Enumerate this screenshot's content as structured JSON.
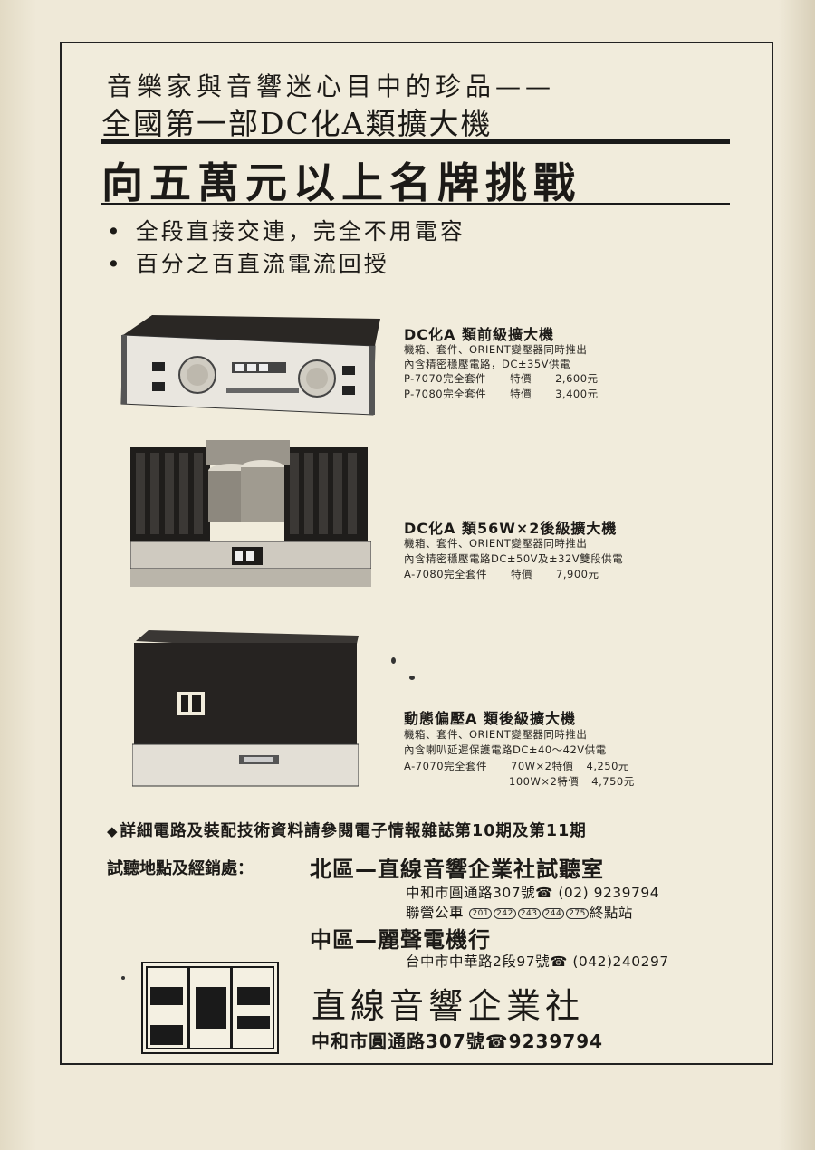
{
  "header": {
    "tagline": "音樂家與音響迷心目中的珍品——",
    "subtitle": "全國第一部DC化A類擴大機",
    "headline": "向五萬元以上名牌挑戰",
    "features": [
      "全段直接交連，完全不用電容",
      "百分之百直流電流回授"
    ],
    "bullet": "•"
  },
  "products": [
    {
      "title": "DC化A 類前級擴大機",
      "lines": [
        "機箱、套件、ORIENT變壓器同時推出",
        "內含精密穩壓電路，DC±35V供電"
      ],
      "prices": [
        {
          "model": "P-7070完全套件",
          "label": "特價",
          "price": "2,600元"
        },
        {
          "model": "P-7080完全套件",
          "label": "特價",
          "price": "3,400元"
        }
      ]
    },
    {
      "title": "DC化A 類56W×2後級擴大機",
      "lines": [
        "機箱、套件、ORIENT變壓器同時推出",
        "內含精密穩壓電路DC±50V及±32V雙段供電"
      ],
      "prices": [
        {
          "model": "A-7080完全套件",
          "label": "特價",
          "price": "7,900元"
        }
      ]
    },
    {
      "title": "動態偏壓A 類後級擴大機",
      "lines": [
        "機箱、套件、ORIENT變壓器同時推出",
        "內含喇叭延遲保護電路DC±40～42V供電"
      ],
      "prices": [
        {
          "model": "A-7070完全套件",
          "label": "70W×2特價",
          "price": "4,250元"
        },
        {
          "model": "",
          "label": "100W×2特價",
          "price": "4,750元"
        }
      ]
    }
  ],
  "notice": {
    "marker": "◆",
    "text": "詳細電路及裝配技術資料請參閱電子情報雜誌第10期及第11期"
  },
  "locations": {
    "label": "試聽地點及經銷處：",
    "north": {
      "name": "北區—直線音響企業社試聽室",
      "address": "中和市圓通路307號",
      "phone": "(02) 9239794",
      "bus_prefix": "聯營公車",
      "bus_routes": [
        "201",
        "242",
        "243",
        "244",
        "275"
      ],
      "bus_suffix": "終點站"
    },
    "central": {
      "name": "中區—麗聲電機行",
      "address": "台中市中華路2段97號",
      "phone": "(042)240297"
    }
  },
  "company": {
    "name": "直線音響企業社",
    "address": "中和市圓通路307號",
    "phone": "9239794"
  },
  "icons": {
    "phone": "☎"
  },
  "colors": {
    "paper": "#f1ecdc",
    "ink": "#1c1a17"
  }
}
